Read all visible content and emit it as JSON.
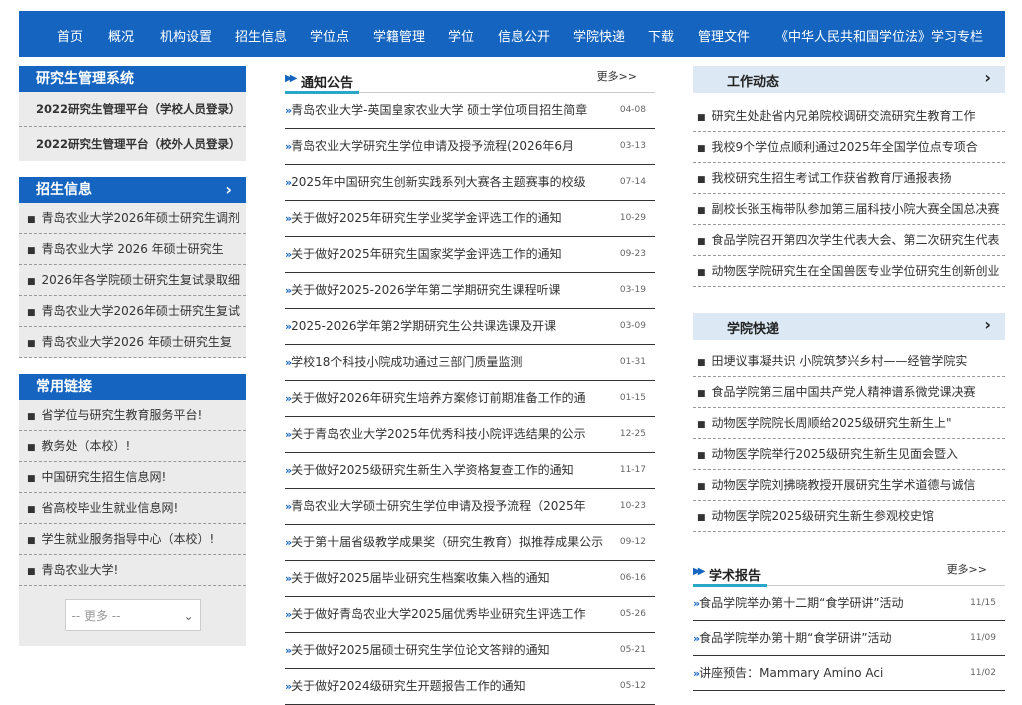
{
  "nav": [
    "首页",
    "概况",
    "机构设置",
    "招生信息",
    "学位点",
    "学籍管理",
    "学位",
    "信息公开",
    "学院快递",
    "下载",
    "管理文件",
    "《中华人民共和国学位法》学习专栏"
  ],
  "left": {
    "system": {
      "title": "研究生管理系统",
      "items": [
        "2022研究生管理平台（学校人员登录）",
        "2022研究生管理平台（校外人员登录）"
      ]
    },
    "admissions": {
      "title": "招生信息",
      "chevron": "›",
      "items": [
        "青岛农业大学2026年硕士研究生调剂",
        "青岛农业大学 2026 年硕士研究生",
        "2026年各学院硕士研究生复试录取细",
        "青岛农业大学2026年硕士研究生复试",
        "青岛农业大学2026 年硕士研究生复"
      ]
    },
    "links": {
      "title": "常用链接",
      "items": [
        "省学位与研究生教育服务平台!",
        "教务处（本校）!",
        "中国研究生招生信息网!",
        "省高校毕业生就业信息网!",
        "学生就业服务指导中心（本校）!",
        "青岛农业大学!"
      ],
      "select_value": "-- 更多 --"
    }
  },
  "notices": {
    "title": "通知公告",
    "more": "更多>>",
    "items": [
      {
        "t": "青岛农业大学-英国皇家农业大学 硕士学位项目招生简章",
        "d": "04-08"
      },
      {
        "t": "青岛农业大学研究生学位申请及授予流程(2026年6月",
        "d": "03-13"
      },
      {
        "t": "2025年中国研究生创新实践系列大赛各主题赛事的校级",
        "d": "07-14"
      },
      {
        "t": "关于做好2025年研究生学业奖学金评选工作的通知",
        "d": "10-29"
      },
      {
        "t": "关于做好2025年研究生国家奖学金评选工作的通知",
        "d": "09-23"
      },
      {
        "t": "关于做好2025-2026学年第二学期研究生课程听课",
        "d": "03-19"
      },
      {
        "t": "2025-2026学年第2学期研究生公共课选课及开课",
        "d": "03-09"
      },
      {
        "t": "学校18个科技小院成功通过三部门质量监测",
        "d": "01-31"
      },
      {
        "t": "关于做好2026年研究生培养方案修订前期准备工作的通",
        "d": "01-15"
      },
      {
        "t": "关于青岛农业大学2025年优秀科技小院评选结果的公示",
        "d": "12-25"
      },
      {
        "t": "关于做好2025级研究生新生入学资格复查工作的通知",
        "d": "11-17"
      },
      {
        "t": "青岛农业大学硕士研究生学位申请及授予流程（2025年",
        "d": "10-23"
      },
      {
        "t": "关于第十届省级教学成果奖（研究生教育）拟推荐成果公示",
        "d": "09-12"
      },
      {
        "t": "关于做好2025届毕业研究生档案收集入档的通知",
        "d": "06-16"
      },
      {
        "t": "关于做好青岛农业大学2025届优秀毕业研究生评选工作",
        "d": "05-26"
      },
      {
        "t": "关于做好2025届硕士研究生学位论文答辩的通知",
        "d": "05-21"
      },
      {
        "t": "关于做好2024级研究生开题报告工作的通知",
        "d": "05-12"
      }
    ]
  },
  "work": {
    "title": "工作动态",
    "chevron": "›",
    "items": [
      "研究生处赴省内兄弟院校调研交流研究生教育工作",
      "我校9个学位点顺利通过2025年全国学位点专项合",
      "我校研究生招生考试工作获省教育厅通报表扬",
      "副校长张玉梅带队参加第三届科技小院大赛全国总决赛",
      "食品学院召开第四次学生代表大会、第二次研究生代表",
      "动物医学院研究生在全国兽医专业学位研究生创新创业"
    ]
  },
  "college": {
    "title": "学院快递",
    "chevron": "›",
    "items": [
      "田埂议事凝共识 小院筑梦兴乡村——经管学院实",
      "食品学院第三届中国共产党人精神谱系微党课决赛",
      "动物医学院院长周顺给2025级研究生新生上\"",
      "动物医学院举行2025级研究生新生见面会暨入",
      "动物医学院刘拂晓教授开展研究生学术道德与诚信",
      "动物医学院2025级研究生新生参观校史馆"
    ]
  },
  "academic": {
    "title": "学术报告",
    "more": "更多>>",
    "items": [
      {
        "t": "食品学院举办第十二期“食学研讲”活动",
        "d": "11/15"
      },
      {
        "t": "食品学院举办第十期“食学研讲”活动",
        "d": "11/09"
      },
      {
        "t": "讲座预告：Mammary Amino Aci",
        "d": "11/02"
      }
    ]
  }
}
